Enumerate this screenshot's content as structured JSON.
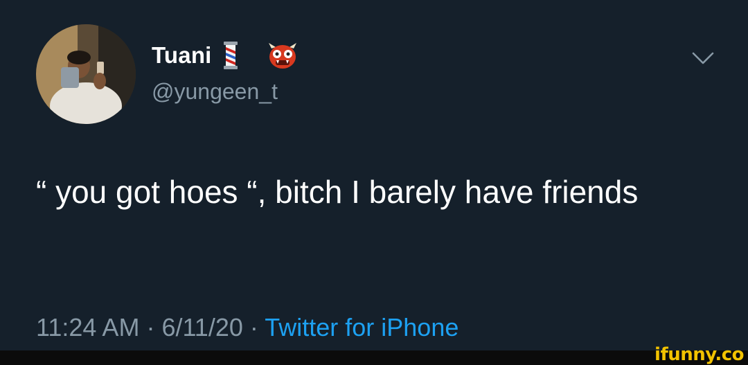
{
  "tweet": {
    "display_name": "Tuani",
    "handle": "@yungeen_t",
    "emojis": [
      "barber-pole-icon",
      "ogre-icon"
    ],
    "text": "“ you got hoes “, bitch I barely have friends",
    "time": "11:24 AM",
    "date": "6/11/20",
    "separator": " · ",
    "source": "Twitter for iPhone"
  },
  "watermark": "ifunny.co",
  "colors": {
    "background": "#15202b",
    "text": "#ffffff",
    "muted": "#8899a6",
    "link": "#1da1f2",
    "watermark": "#f2c200"
  }
}
